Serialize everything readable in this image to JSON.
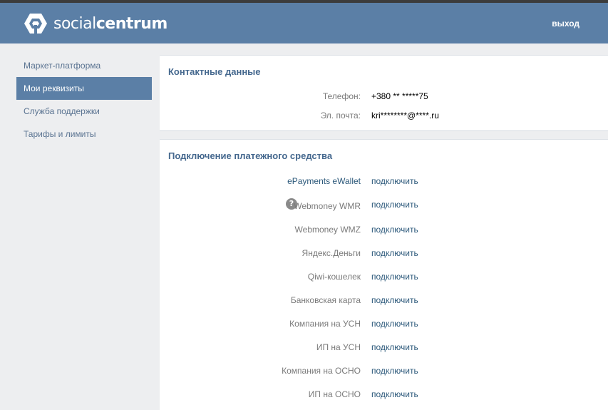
{
  "header": {
    "logo_text_a": "social",
    "logo_text_b": "centrum",
    "logout_label": "выход"
  },
  "sidebar": {
    "items": [
      {
        "label": "Маркет-платформа",
        "active": false
      },
      {
        "label": "Мои реквизиты",
        "active": true
      },
      {
        "label": "Служба поддержки",
        "active": false
      },
      {
        "label": "Тарифы и лимиты",
        "active": false
      }
    ]
  },
  "contacts": {
    "title": "Контактные данные",
    "phone_label": "Телефон:",
    "phone_value": "+380 ** *****75",
    "email_label": "Эл. почта:",
    "email_value": "kri********@****.ru"
  },
  "payments": {
    "title": "Подключение платежного средства",
    "connect_label": "подключить",
    "methods": [
      "ePayments eWallet",
      "Webmoney WMR",
      "Webmoney WMZ",
      "Яндекс.Деньги",
      "Qiwi-кошелек",
      "Банковская карта",
      "Компания на УСН",
      "ИП на УСН",
      "Компания на ОСНО",
      "ИП на ОСНО"
    ],
    "help_icon_text": "?"
  },
  "colors": {
    "header_bg": "#5b7fa6",
    "link": "#2b587a",
    "title": "#45688e"
  }
}
